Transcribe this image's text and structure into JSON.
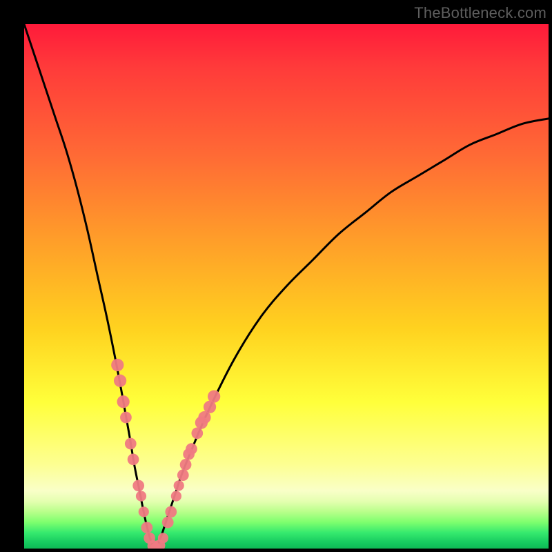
{
  "watermark": "TheBottleneck.com",
  "colors": {
    "curve_stroke": "#000000",
    "marker_fill": "#ef7a82",
    "marker_stroke": "#ef7a82",
    "gradient_top": "#ff1a3a",
    "gradient_bottom": "#0fb956",
    "background": "#000000"
  },
  "chart_data": {
    "type": "line",
    "title": "",
    "xlabel": "",
    "ylabel": "",
    "xlim": [
      0,
      100
    ],
    "ylim": [
      0,
      100
    ],
    "grid": false,
    "legend": false,
    "description": "Two-sided bottleneck curve. Score drops from 100 at x=0 to 0 near x≈25 (the balanced point), then rises back toward ~82 at x=100. Pink markers highlight the region near the minimum on both branches.",
    "series": [
      {
        "name": "bottleneck-curve",
        "x": [
          0,
          2,
          4,
          6,
          8,
          10,
          12,
          14,
          16,
          18,
          20,
          21,
          22,
          23,
          24,
          25,
          26,
          27,
          28,
          29,
          30,
          32,
          35,
          40,
          45,
          50,
          55,
          60,
          65,
          70,
          75,
          80,
          85,
          90,
          95,
          100
        ],
        "values": [
          100,
          94,
          88,
          82,
          76,
          69,
          61,
          52,
          43,
          33,
          22,
          16,
          11,
          6,
          2,
          0,
          2,
          5,
          8,
          11,
          14,
          19,
          26,
          36,
          44,
          50,
          55,
          60,
          64,
          68,
          71,
          74,
          77,
          79,
          81,
          82
        ]
      }
    ],
    "markers": {
      "name": "marker-cluster",
      "points": [
        {
          "x": 17.8,
          "y": 35,
          "r": 1.2
        },
        {
          "x": 18.3,
          "y": 32,
          "r": 1.2
        },
        {
          "x": 18.9,
          "y": 28,
          "r": 1.2
        },
        {
          "x": 19.4,
          "y": 25,
          "r": 1.1
        },
        {
          "x": 20.3,
          "y": 20,
          "r": 1.1
        },
        {
          "x": 20.8,
          "y": 17,
          "r": 1.1
        },
        {
          "x": 21.8,
          "y": 12,
          "r": 1.1
        },
        {
          "x": 22.3,
          "y": 10,
          "r": 1.0
        },
        {
          "x": 22.8,
          "y": 7,
          "r": 1.0
        },
        {
          "x": 23.4,
          "y": 4,
          "r": 1.1
        },
        {
          "x": 23.9,
          "y": 2,
          "r": 1.1
        },
        {
          "x": 24.6,
          "y": 0.5,
          "r": 1.1
        },
        {
          "x": 25.1,
          "y": 0,
          "r": 1.1
        },
        {
          "x": 25.8,
          "y": 0.6,
          "r": 1.1
        },
        {
          "x": 26.5,
          "y": 2,
          "r": 1.0
        },
        {
          "x": 27.4,
          "y": 5,
          "r": 1.1
        },
        {
          "x": 28.0,
          "y": 7,
          "r": 1.1
        },
        {
          "x": 29.0,
          "y": 10,
          "r": 1.0
        },
        {
          "x": 29.5,
          "y": 12,
          "r": 1.0
        },
        {
          "x": 30.3,
          "y": 14,
          "r": 1.1
        },
        {
          "x": 30.8,
          "y": 16,
          "r": 1.1
        },
        {
          "x": 31.4,
          "y": 18,
          "r": 1.1
        },
        {
          "x": 31.9,
          "y": 19,
          "r": 1.1
        },
        {
          "x": 33.0,
          "y": 22,
          "r": 1.1
        },
        {
          "x": 33.8,
          "y": 24,
          "r": 1.2
        },
        {
          "x": 34.4,
          "y": 25,
          "r": 1.2
        },
        {
          "x": 35.4,
          "y": 27,
          "r": 1.2
        },
        {
          "x": 36.2,
          "y": 29,
          "r": 1.2
        }
      ]
    }
  }
}
